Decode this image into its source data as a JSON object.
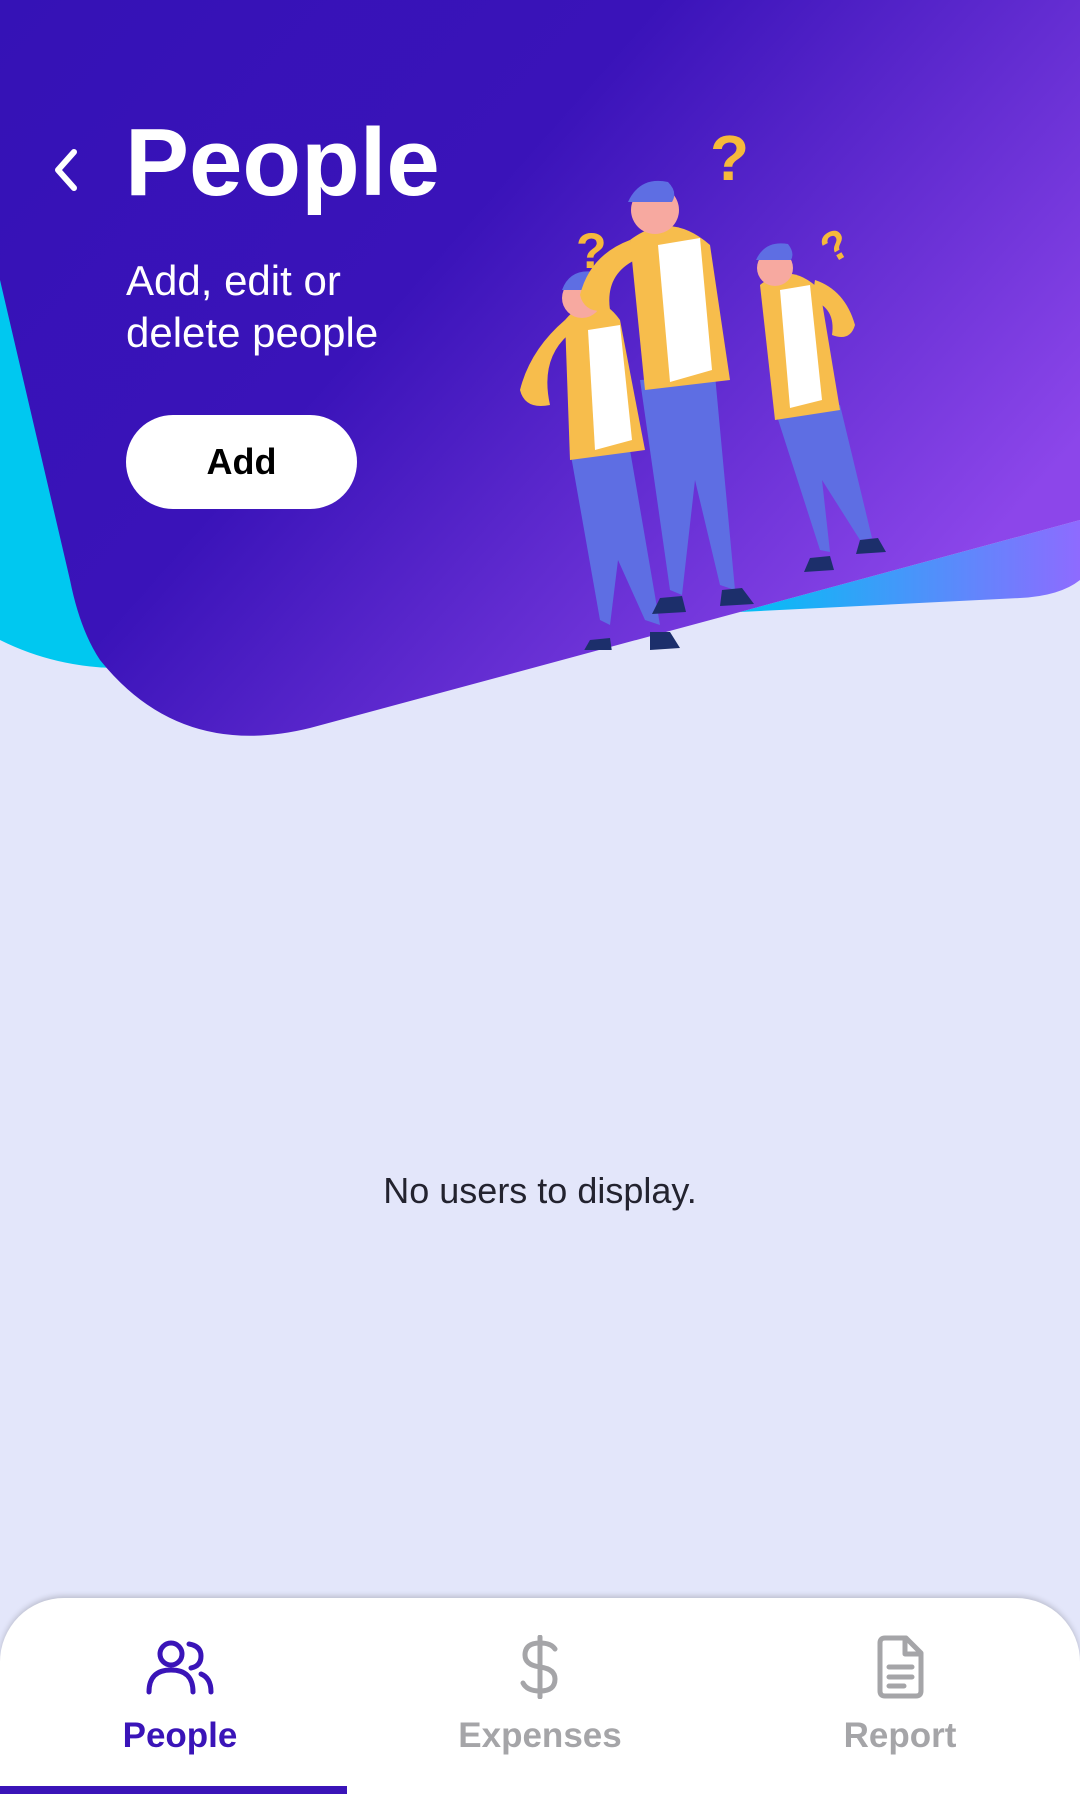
{
  "header": {
    "title": "People",
    "subtitle": "Add, edit or delete people",
    "add_label": "Add",
    "back_icon": "chevron-left-icon"
  },
  "main": {
    "empty_message": "No users to display."
  },
  "bottom_nav": {
    "items": [
      {
        "label": "People",
        "icon": "people-icon",
        "active": true
      },
      {
        "label": "Expenses",
        "icon": "dollar-icon",
        "active": false
      },
      {
        "label": "Report",
        "icon": "document-icon",
        "active": false
      }
    ]
  },
  "colors": {
    "hero_primary": "#3512b6",
    "hero_gradient_end": "#8c46ea",
    "accent_cyan": "#00c8f0",
    "background": "#e3e6fa",
    "active_nav": "#3a14b8",
    "inactive_nav": "#a5a5a8"
  }
}
